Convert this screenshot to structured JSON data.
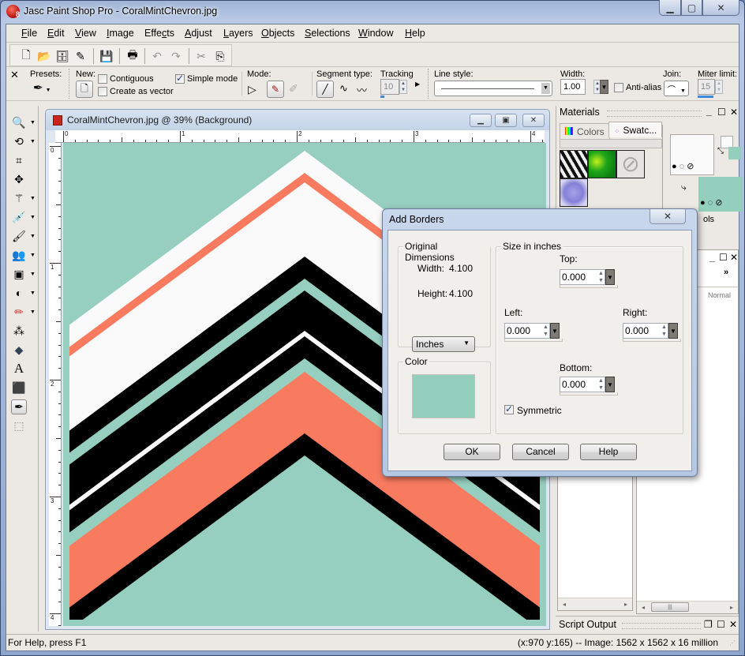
{
  "window": {
    "title": "Jasc Paint Shop Pro - CoralMintChevron.jpg",
    "app_icon_badge": "8",
    "controls": {
      "minimize": "▁",
      "maximize": "▢",
      "close": "✕"
    }
  },
  "menu": [
    {
      "label": "File",
      "accel": "F"
    },
    {
      "label": "Edit",
      "accel": "E"
    },
    {
      "label": "View",
      "accel": "V"
    },
    {
      "label": "Image",
      "accel": "I"
    },
    {
      "label": "Effects",
      "accel": "c"
    },
    {
      "label": "Adjust",
      "accel": "A"
    },
    {
      "label": "Layers",
      "accel": "L"
    },
    {
      "label": "Objects",
      "accel": "O"
    },
    {
      "label": "Selections",
      "accel": "S"
    },
    {
      "label": "Window",
      "accel": "W"
    },
    {
      "label": "Help",
      "accel": "H"
    }
  ],
  "toolbar": {
    "buttons": [
      {
        "name": "new",
        "glyph": "🗋"
      },
      {
        "name": "open",
        "glyph": "📂"
      },
      {
        "name": "browse",
        "glyph": "🗄"
      },
      {
        "name": "scan",
        "glyph": "✎"
      },
      {
        "name": "save",
        "glyph": "💾"
      },
      {
        "name": "print",
        "glyph": "🖶"
      },
      {
        "name": "undo",
        "glyph": "↶"
      },
      {
        "name": "redo",
        "glyph": "↷"
      },
      {
        "name": "cut",
        "glyph": "✂"
      },
      {
        "name": "copy",
        "glyph": "⎘"
      }
    ]
  },
  "tool_options": {
    "close": "✕",
    "presets_label": "Presets:",
    "new_label": "New:",
    "contiguous_label": "Contiguous",
    "contiguous_checked": false,
    "create_as_vector_label": "Create as vector",
    "create_as_vector_checked": false,
    "simple_mode_label": "Simple mode",
    "simple_mode_checked": true,
    "mode_label": "Mode:",
    "segment_type_label": "Segment type:",
    "tracking_label": "Tracking",
    "tracking_value": "10",
    "line_style_label": "Line style:",
    "width_label": "Width:",
    "width_value": "1.00",
    "anti_alias_label": "Anti-alias",
    "anti_alias_checked": false,
    "join_label": "Join:",
    "miter_limit_label": "Miter limit:",
    "miter_limit_value": "15"
  },
  "tools": [
    {
      "name": "zoom",
      "glyph": "🔍",
      "has_menu": true
    },
    {
      "name": "deform",
      "glyph": "⟲",
      "has_menu": true
    },
    {
      "name": "crop",
      "glyph": "⌗",
      "has_menu": false
    },
    {
      "name": "move",
      "glyph": "✥",
      "has_menu": false
    },
    {
      "name": "magic-wand",
      "glyph": "⚚",
      "has_menu": true
    },
    {
      "name": "dropper",
      "glyph": "💉",
      "has_menu": true
    },
    {
      "name": "paint-brush",
      "glyph": "🖌",
      "has_menu": true
    },
    {
      "name": "clone",
      "glyph": "👥",
      "has_menu": true
    },
    {
      "name": "lighten",
      "glyph": "▣",
      "has_menu": true
    },
    {
      "name": "dodge",
      "glyph": "◐",
      "has_menu": true
    },
    {
      "name": "eraser",
      "glyph": "✏",
      "has_menu": true
    },
    {
      "name": "picture-tube",
      "glyph": "⁂",
      "has_menu": false
    },
    {
      "name": "flood-fill",
      "glyph": "◆",
      "has_menu": false
    },
    {
      "name": "text",
      "glyph": "A",
      "has_menu": false
    },
    {
      "name": "preset-shape",
      "glyph": "⬛",
      "has_menu": false
    },
    {
      "name": "pen",
      "glyph": "✒",
      "has_menu": false,
      "active": true
    },
    {
      "name": "object-selector",
      "glyph": "⬚",
      "has_menu": false
    }
  ],
  "document": {
    "title": "CoralMintChevron.jpg @  39% (Background)",
    "zoom_percent": 39,
    "ruler_h": [
      "0",
      "1",
      "2",
      "3",
      "4"
    ],
    "ruler_v": [
      "0",
      "1",
      "2",
      "3",
      "4"
    ],
    "colors": {
      "mint": "#96cfbf",
      "coral": "#f97b5f",
      "white": "#fafafa",
      "black": "#000000"
    }
  },
  "materials": {
    "title": "Materials",
    "tabs": [
      {
        "label": "Colors",
        "selected": false
      },
      {
        "label": "Swatc...",
        "selected": true
      }
    ],
    "swatches": [
      "zebra",
      "green",
      "none",
      "purple-bubbles"
    ],
    "foreground_color": "#fafafa",
    "background_color": "#94cfbd",
    "partial_label": "ols"
  },
  "layers": {
    "blend_mode": "Normal",
    "more": "»"
  },
  "script_output": {
    "title": "Script Output"
  },
  "statusbar": {
    "help": "For Help, press F1",
    "info": "(x:970 y:165) -- Image:  1562 x 1562 x 16 million"
  },
  "dialog": {
    "title": "Add Borders",
    "close": "✕",
    "original_dimensions": {
      "legend": "Original Dimensions",
      "width_label": "Width:",
      "width_value": "4.100",
      "height_label": "Height:",
      "height_value": "4.100"
    },
    "units": "Inches",
    "color": {
      "legend": "Color",
      "value": "#94cfbd"
    },
    "size": {
      "legend": "Size in inches",
      "top_label": "Top:",
      "top_value": "0.000",
      "left_label": "Left:",
      "left_value": "0.000",
      "right_label": "Right:",
      "right_value": "0.000",
      "bottom_label": "Bottom:",
      "bottom_value": "0.000"
    },
    "symmetric_label": "Symmetric",
    "symmetric_checked": true,
    "buttons": {
      "ok": "OK",
      "cancel": "Cancel",
      "help": "Help"
    }
  }
}
